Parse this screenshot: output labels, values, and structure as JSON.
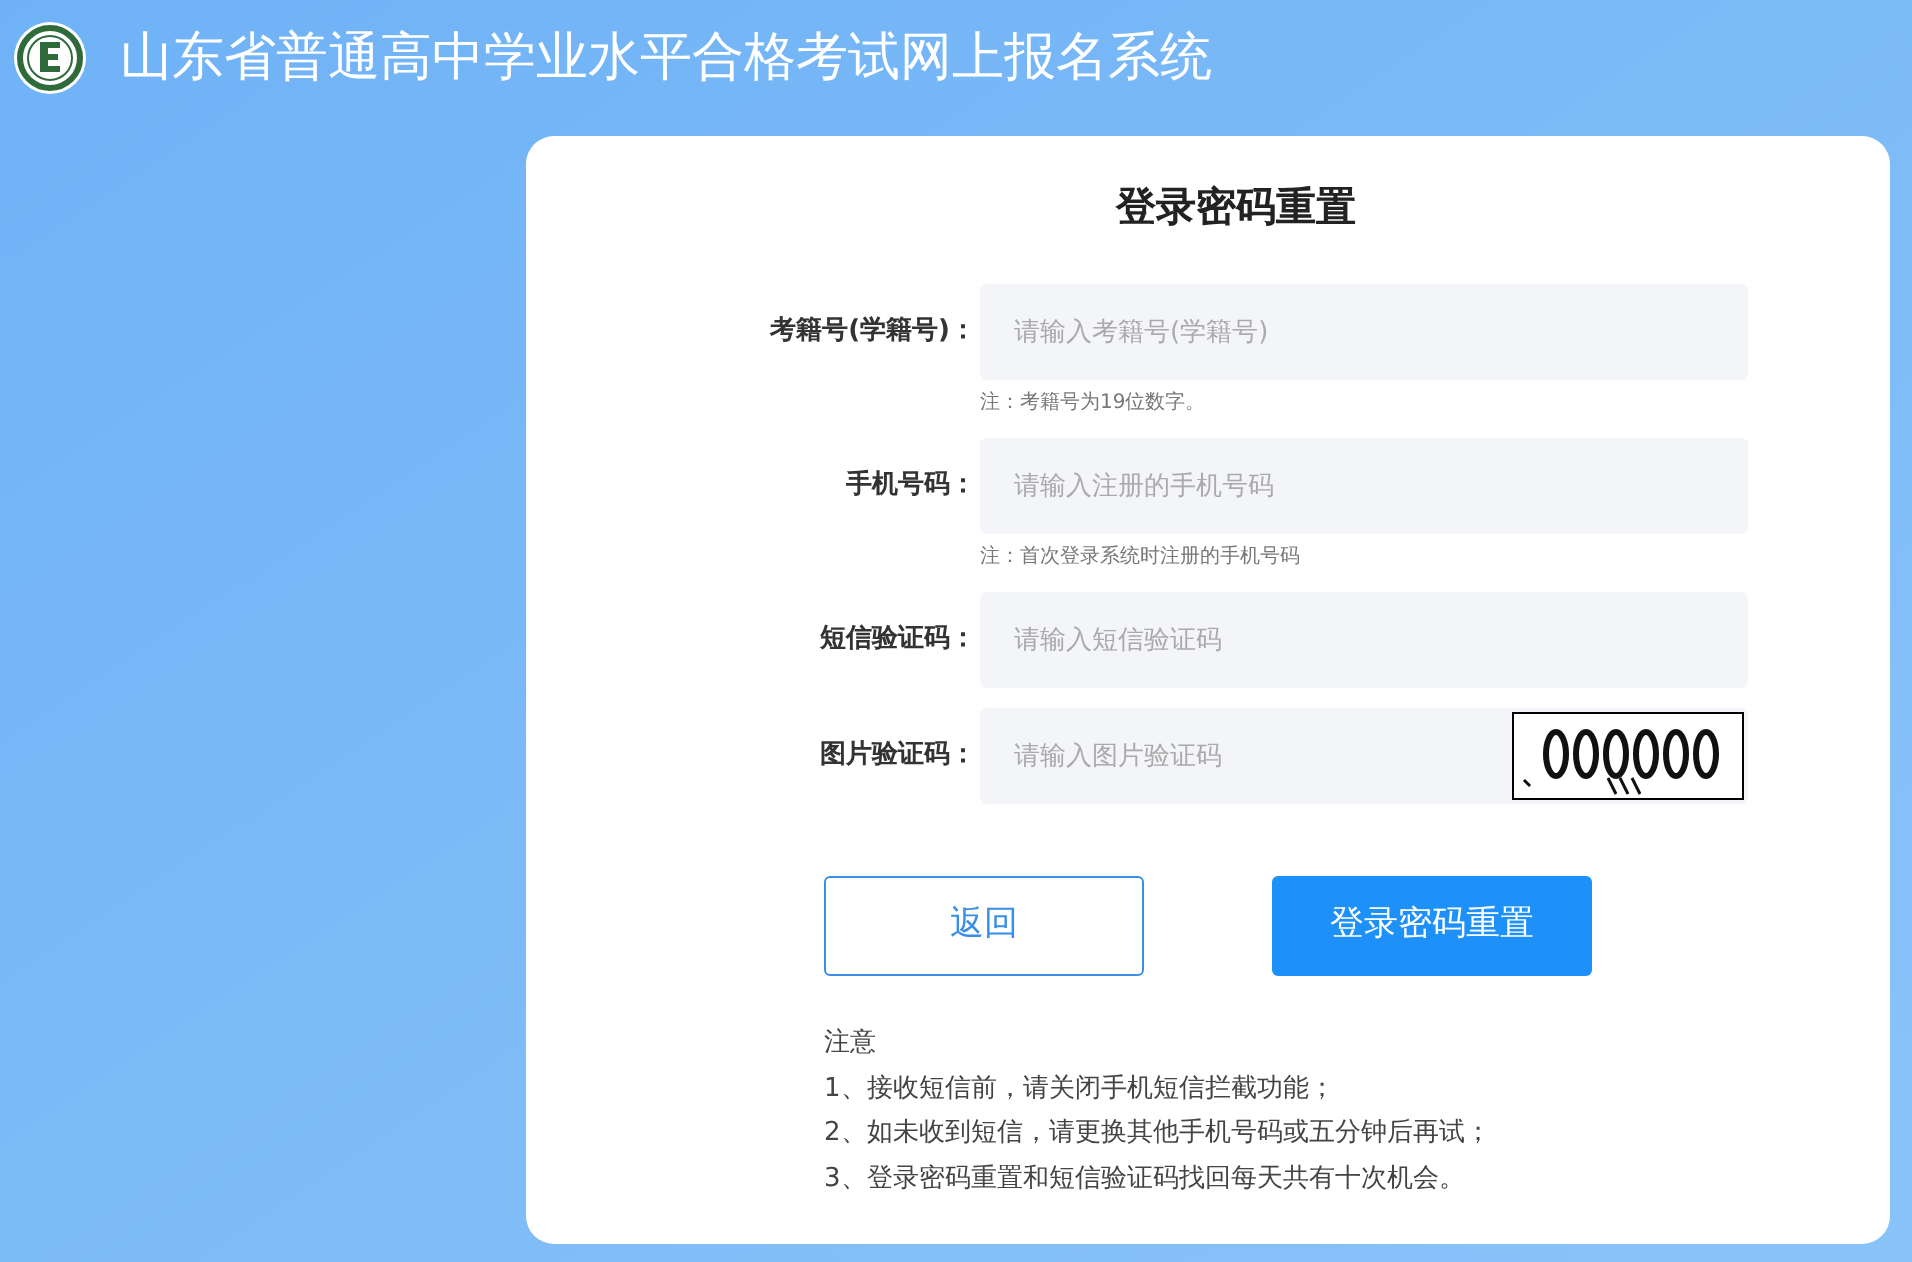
{
  "header": {
    "title": "山东省普通高中学业水平合格考试网上报名系统"
  },
  "form": {
    "title": "登录密码重置",
    "fields": [
      {
        "kind": "text",
        "label": "考籍号(学籍号)：",
        "placeholder": "请输入考籍号(学籍号)",
        "note": "注：考籍号为19位数字。"
      },
      {
        "kind": "text",
        "label": "手机号码：",
        "placeholder": "请输入注册的手机号码",
        "note": "注：首次登录系统时注册的手机号码"
      },
      {
        "kind": "text",
        "label": "短信验证码：",
        "placeholder": "请输入短信验证码"
      },
      {
        "kind": "captcha",
        "label": "图片验证码：",
        "placeholder": "请输入图片验证码"
      }
    ],
    "buttons": [
      {
        "kind": "outline",
        "label": "返回"
      },
      {
        "kind": "primary",
        "label": "登录密码重置"
      }
    ],
    "notice": {
      "heading": "注意",
      "items": [
        "1、接收短信前，请关闭手机短信拦截功能；",
        "2、如未收到短信，请更换其他手机号码或五分钟后再试；",
        "3、登录密码重置和短信验证码找回每天共有十次机会。"
      ]
    }
  }
}
